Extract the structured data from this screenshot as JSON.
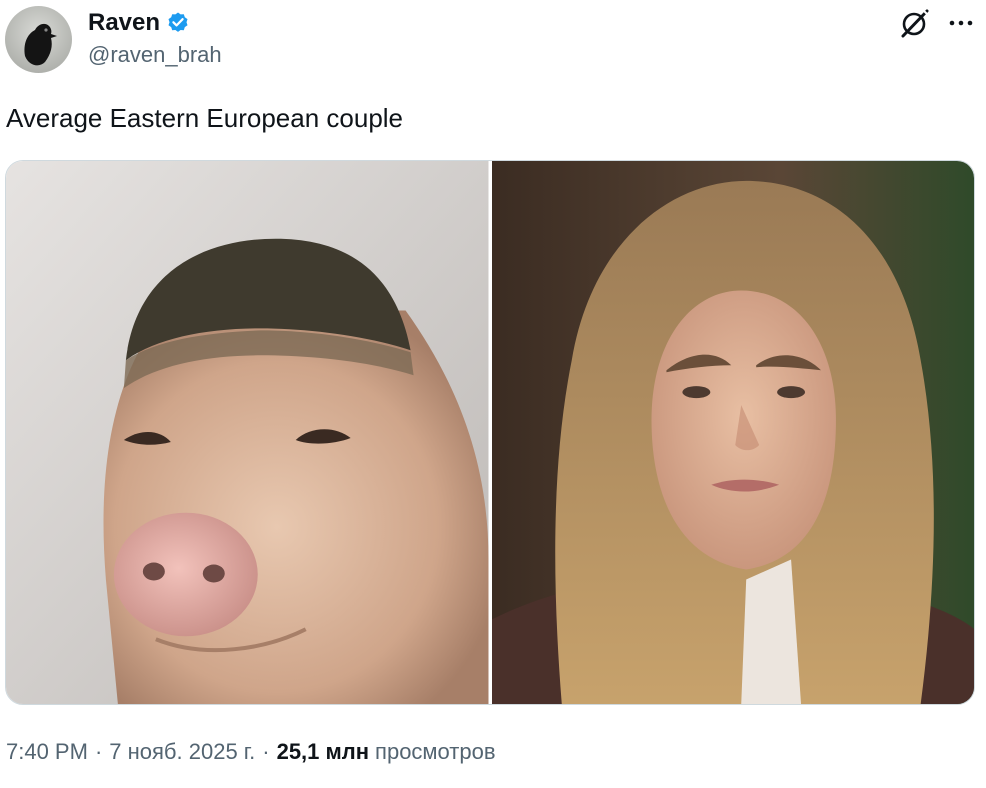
{
  "author": {
    "display_name": "Raven",
    "handle": "@raven_brah",
    "verified": true,
    "avatar_icon": "raven-avatar"
  },
  "tweet": {
    "text": "Average Eastern European couple"
  },
  "media": [
    {
      "description_icon": "pig-face-photo"
    },
    {
      "description_icon": "woman-portrait-photo"
    }
  ],
  "meta": {
    "time": "7:40 PM",
    "separator": "·",
    "date": "7 нояб. 2025 г.",
    "views_count": "25,1 млн",
    "views_label": "просмотров"
  },
  "colors": {
    "verified": "#1d9bf0",
    "secondary_text": "#536471",
    "primary_text": "#0f1419"
  }
}
